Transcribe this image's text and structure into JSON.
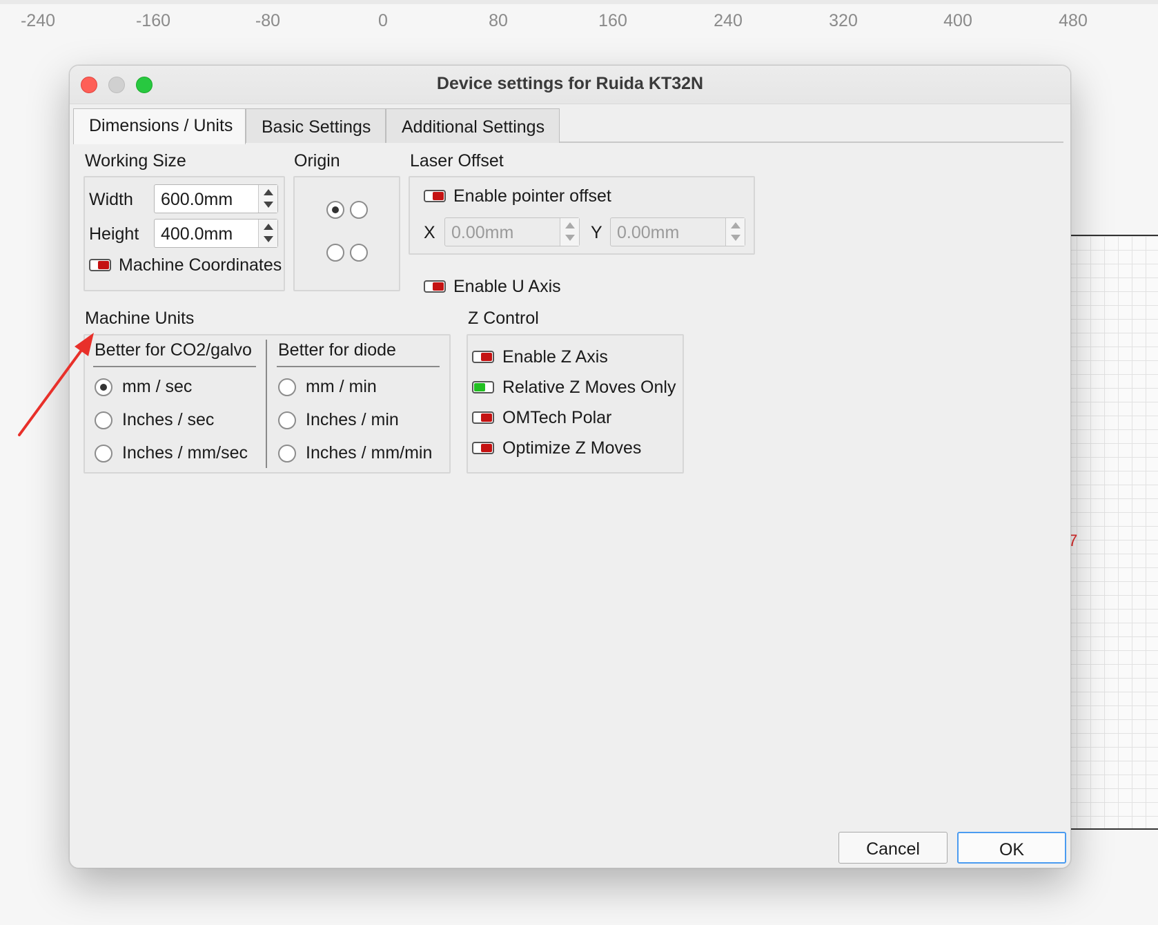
{
  "ruler": {
    "ticks": [
      "-240",
      "-160",
      "-80",
      "0",
      "80",
      "160",
      "240",
      "320",
      "400",
      "480"
    ]
  },
  "dialog": {
    "title": "Device settings for Ruida KT32N",
    "tabs": [
      {
        "label": "Dimensions / Units",
        "active": true
      },
      {
        "label": "Basic Settings",
        "active": false
      },
      {
        "label": "Additional Settings",
        "active": false
      }
    ],
    "working_size": {
      "heading": "Working Size",
      "width_label": "Width",
      "width_value": "600.0mm",
      "height_label": "Height",
      "height_value": "400.0mm",
      "machine_coords_label": "Machine Coordinates",
      "machine_coords_on": false
    },
    "origin": {
      "heading": "Origin",
      "selected": "top-left"
    },
    "laser_offset": {
      "heading": "Laser Offset",
      "enable_pointer_label": "Enable pointer offset",
      "enable_pointer_on": false,
      "x_label": "X",
      "x_value": "0.00mm",
      "y_label": "Y",
      "y_value": "0.00mm"
    },
    "u_axis": {
      "label": "Enable U Axis",
      "on": false
    },
    "machine_units": {
      "heading": "Machine Units",
      "co2": {
        "heading": "Better for CO2/galvo",
        "options": [
          "mm / sec",
          "Inches / sec",
          "Inches / mm/sec"
        ],
        "selected": "mm / sec"
      },
      "diode": {
        "heading": "Better for diode",
        "options": [
          "mm / min",
          "Inches / min",
          "Inches / mm/min"
        ]
      }
    },
    "z_control": {
      "heading": "Z Control",
      "items": [
        {
          "label": "Enable Z Axis",
          "on": false
        },
        {
          "label": "Relative Z Moves Only",
          "on": true
        },
        {
          "label": "OMTech Polar",
          "on": false
        },
        {
          "label": "Optimize Z Moves",
          "on": false
        }
      ]
    },
    "buttons": {
      "cancel": "Cancel",
      "ok": "OK"
    }
  },
  "annotation_color": "#e8302a",
  "canvas_mark": "7"
}
